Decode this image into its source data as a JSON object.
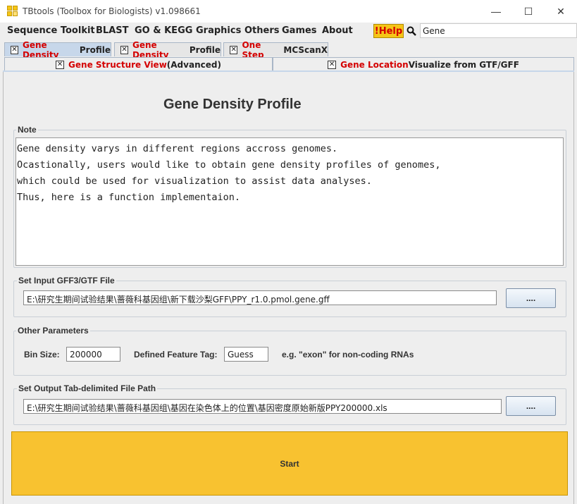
{
  "window": {
    "title": "TBtools (Toolbox for Biologists) v1.098661",
    "minimize": "—",
    "maximize": "☐",
    "close": "✕"
  },
  "menu": {
    "items": [
      "Sequence Toolkit",
      "BLAST",
      "GO & KEGG",
      "Graphics",
      "Others",
      "Games",
      "About"
    ],
    "help_label": "!Help",
    "search_value": "Gene"
  },
  "tabs": {
    "row1": [
      {
        "close": "✕",
        "red": "Gene Density",
        "rest": " Profile"
      },
      {
        "close": "✕",
        "red": "Gene Density",
        "rest": " Profile"
      },
      {
        "close": "✕",
        "red": "One Step",
        "rest": " MCScanX"
      }
    ],
    "row2": [
      {
        "close": "✕",
        "red": "Gene Structure View",
        "rest": " (Advanced)"
      },
      {
        "close": "✕",
        "red": "Gene Location",
        "rest": " Visualize from GTF/GFF"
      }
    ]
  },
  "page": {
    "title": "Gene Density Profile",
    "note_label": "Note",
    "note_text": "Gene density varys in different regions accross genomes.\nOcastionally, users would like to obtain gene density profiles of genomes,\nwhich could be used for visualization to assist data analyses.\nThus, here is a function implementaion.",
    "input_label": "Set Input GFF3/GTF File",
    "input_path": "E:\\研究生期间试验结果\\蔷薇科基因组\\新下载沙梨GFF\\PPY_r1.0.pmol.gene.gff",
    "browse_label": "....",
    "params_label": "Other Parameters",
    "bin_size_label": "Bin Size:",
    "bin_size_value": "200000",
    "feature_tag_label": "Defined Feature Tag:",
    "feature_tag_value": "Guess",
    "feature_hint": "e.g. \"exon\" for non-coding RNAs",
    "output_label": "Set Output Tab-delimited File Path",
    "output_path": "E:\\研究生期间试验结果\\蔷薇科基因组\\基因在染色体上的位置\\基因密度原始新版PPY200000.xls",
    "start_label": "Start"
  }
}
